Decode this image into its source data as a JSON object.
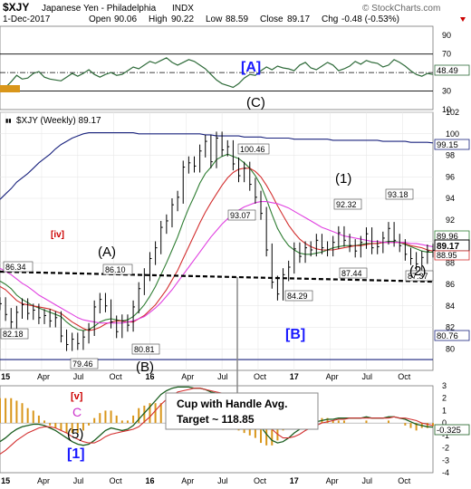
{
  "header": {
    "symbol": "$XJY",
    "name": "Japanese Yen - Philadelphia",
    "exchange": "INDX",
    "date": "1-Dec-2017",
    "open_label": "Open",
    "open": "90.06",
    "high_label": "High",
    "high": "90.22",
    "low_label": "Low",
    "low": "88.59",
    "close_label": "Close",
    "close": "89.17",
    "chg_label": "Chg",
    "chg": "-0.48 (-0.53%)",
    "watermark": "© StockCharts.com"
  },
  "colors": {
    "price": "#000000",
    "ma_green": "#2e7d32",
    "ma_red": "#d32f2f",
    "ma_magenta": "#e040e0",
    "ma_navy": "#1a237e",
    "rsi_line": "#2f6b3a",
    "macd_line": "#1b5e20",
    "signal_line": "#d32f2f",
    "hist": "#d9961a",
    "wave_blue": "#1a1aff",
    "wave_red": "#cc0000",
    "wave_magenta": "#cc33cc"
  },
  "chart_data": [
    {
      "type": "line",
      "title": "",
      "ylim": [
        10,
        100
      ],
      "y_ticks": [
        10,
        30,
        50,
        70,
        90
      ],
      "reference_lines": [
        70,
        50,
        30
      ],
      "last_value": "48.49",
      "x_ticks": [
        "15",
        "Apr",
        "Jul",
        "Oct",
        "16",
        "Apr",
        "Jul",
        "Oct",
        "17",
        "Apr",
        "Jul",
        "Oct"
      ],
      "x": [
        0,
        2,
        4,
        6,
        8,
        10,
        12,
        14,
        16,
        18,
        20,
        22,
        24,
        26,
        28,
        30,
        32,
        34,
        36,
        38,
        40,
        42,
        44,
        46,
        48,
        50,
        52,
        54,
        56,
        58,
        60,
        62,
        64,
        66,
        68,
        70,
        72,
        74,
        76,
        78,
        80,
        82,
        84,
        86,
        88,
        90,
        92,
        94,
        96,
        98,
        100,
        102,
        104,
        106,
        108,
        110,
        112,
        114,
        116,
        118,
        120,
        122,
        124,
        126,
        128,
        130,
        132,
        134,
        136,
        138,
        140,
        142,
        144,
        146,
        148,
        150,
        152,
        154,
        156
      ],
      "series": [
        {
          "name": "",
          "values": [
            30,
            34,
            40,
            47,
            43,
            44,
            49,
            51,
            45,
            43,
            42,
            41,
            45,
            49,
            46,
            49,
            53,
            48,
            45,
            48,
            50,
            47,
            48,
            52,
            56,
            54,
            58,
            62,
            60,
            63,
            66,
            61,
            58,
            61,
            64,
            62,
            58,
            54,
            48,
            42,
            38,
            36,
            34,
            38,
            44,
            48,
            47,
            52,
            56,
            53,
            57,
            55,
            54,
            52,
            58,
            61,
            55,
            53,
            57,
            61,
            58,
            52,
            54,
            57,
            62,
            59,
            63,
            61,
            60,
            56,
            58,
            64,
            61,
            57,
            52,
            48,
            46,
            49,
            48
          ]
        }
      ]
    },
    {
      "type": "line",
      "title": "$XJY (Weekly) 89.17",
      "ylim": [
        78,
        102
      ],
      "y_ticks": [
        80,
        82,
        84,
        86,
        88,
        90,
        92,
        94,
        96,
        98,
        100,
        102
      ],
      "x_ticks": [
        "15",
        "Apr",
        "Jul",
        "Oct",
        "16",
        "Apr",
        "Jul",
        "Oct",
        "17",
        "Apr",
        "Jul",
        "Oct"
      ],
      "x": [
        0,
        2,
        4,
        6,
        8,
        10,
        12,
        14,
        16,
        18,
        20,
        22,
        24,
        26,
        28,
        30,
        32,
        34,
        36,
        38,
        40,
        42,
        44,
        46,
        48,
        50,
        52,
        54,
        56,
        58,
        60,
        62,
        64,
        66,
        68,
        70,
        72,
        74,
        76,
        78,
        80,
        82,
        84,
        86,
        88,
        90,
        92,
        94,
        96,
        98,
        100,
        102,
        104,
        106,
        108,
        110,
        112,
        114,
        116,
        118,
        120,
        122,
        124,
        126,
        128,
        130,
        132,
        134,
        136,
        138,
        140,
        142,
        144,
        146,
        148,
        150,
        152,
        154,
        156
      ],
      "series": [
        {
          "name": "",
          "values": [
            84.2,
            83.2,
            82.5,
            83.4,
            84.1,
            83.3,
            83.6,
            82.9,
            83.1,
            82.6,
            82.9,
            81.2,
            80.4,
            80.9,
            80.5,
            81.1,
            81.8,
            83.9,
            84.6,
            84.0,
            82.5,
            81.6,
            82.6,
            82.2,
            83.9,
            85.6,
            86.9,
            88.4,
            89.4,
            91.3,
            91.9,
            93.4,
            94.1,
            96.9,
            97.3,
            97.0,
            98.4,
            99.3,
            97.4,
            99.6,
            98.5,
            98.8,
            97.2,
            96.1,
            96.8,
            95.3,
            94.1,
            92.6,
            89.2,
            86.2,
            85.1,
            86.9,
            87.6,
            89.3,
            88.6,
            89.4,
            89.2,
            90.1,
            89.4,
            89.2,
            89.9,
            90.8,
            90.1,
            89.6,
            89.1,
            89.9,
            90.7,
            89.4,
            89.5,
            90.3,
            91.2,
            90.1,
            89.6,
            88.8,
            88.4,
            87.9,
            88.5,
            89.1,
            89.17
          ]
        },
        {
          "name": "",
          "values": [
            86.3,
            86.0,
            85.6,
            85.0,
            84.6,
            84.3,
            84.0,
            83.8,
            83.6,
            83.4,
            83.2,
            83.0,
            82.5,
            82.1,
            81.8,
            81.7,
            81.8,
            82.1,
            82.5,
            82.7,
            82.8,
            82.7,
            82.6,
            82.7,
            83.0,
            83.5,
            84.1,
            84.9,
            85.8,
            86.9,
            88.0,
            89.2,
            90.4,
            91.8,
            93.1,
            94.2,
            95.4,
            96.3,
            96.9,
            97.6,
            97.9,
            98.1,
            97.9,
            97.7,
            97.3,
            96.8,
            96.1,
            95.2,
            93.9,
            92.5,
            91.2,
            90.3,
            89.6,
            89.2,
            88.9,
            88.8,
            88.8,
            88.9,
            89.0,
            89.2,
            89.4,
            89.5,
            89.6,
            89.6,
            89.6,
            89.7,
            89.8,
            89.8,
            89.8,
            89.9,
            90.0,
            90.0,
            89.9,
            89.7,
            89.5,
            89.3,
            89.1,
            89.0,
            89.0
          ]
        },
        {
          "name": "",
          "values": [
            85.8,
            85.5,
            85.0,
            84.5,
            84.2,
            84.1,
            84.0,
            83.9,
            83.8,
            83.7,
            83.5,
            83.3,
            82.9,
            82.5,
            82.2,
            81.9,
            81.7,
            81.8,
            82.0,
            82.3,
            82.5,
            82.6,
            82.6,
            82.5,
            82.5,
            82.8,
            83.1,
            83.6,
            84.1,
            84.8,
            85.5,
            86.4,
            87.3,
            88.4,
            89.5,
            90.6,
            91.7,
            92.7,
            93.6,
            94.4,
            95.2,
            95.9,
            96.4,
            96.7,
            96.8,
            96.8,
            96.5,
            96.0,
            95.2,
            94.3,
            93.3,
            92.4,
            91.5,
            90.8,
            90.2,
            89.8,
            89.5,
            89.3,
            89.2,
            89.2,
            89.2,
            89.3,
            89.4,
            89.5,
            89.6,
            89.6,
            89.7,
            89.8,
            89.8,
            89.9,
            89.9,
            89.9,
            89.9,
            89.8,
            89.6,
            89.5,
            89.4,
            89.2,
            89.1
          ]
        },
        {
          "name": "",
          "values": [
            87.5,
            87.2,
            86.9,
            86.5,
            86.1,
            85.8,
            85.4,
            85.0,
            84.7,
            84.4,
            84.1,
            83.8,
            83.5,
            83.2,
            82.9,
            82.7,
            82.6,
            82.5,
            82.4,
            82.4,
            82.4,
            82.4,
            82.4,
            82.5,
            82.6,
            82.8,
            83.0,
            83.4,
            83.8,
            84.3,
            84.9,
            85.5,
            86.2,
            86.9,
            87.6,
            88.3,
            89.0,
            89.7,
            90.4,
            91.0,
            91.6,
            92.1,
            92.5,
            92.9,
            93.2,
            93.4,
            93.6,
            93.7,
            93.7,
            93.6,
            93.5,
            93.3,
            93.1,
            92.8,
            92.5,
            92.2,
            91.9,
            91.6,
            91.3,
            91.1,
            90.9,
            90.7,
            90.5,
            90.4,
            90.3,
            90.2,
            90.1,
            90.0,
            90.0,
            89.9,
            89.9,
            89.9,
            89.9,
            89.9,
            89.8,
            89.8,
            89.7,
            89.6,
            89.5
          ]
        },
        {
          "name": "",
          "values": [
            93.9,
            94.4,
            94.9,
            95.5,
            95.9,
            96.3,
            96.8,
            97.3,
            97.7,
            98.1,
            98.6,
            99.0,
            99.3,
            99.6,
            99.8,
            100.0,
            100.1,
            100.1,
            100.1,
            100.1,
            100.1,
            100.1,
            100.1,
            100.1,
            100.1,
            100.0,
            100.0,
            100.0,
            100.0,
            100.0,
            100.0,
            100.0,
            100.0,
            100.0,
            100.0,
            100.0,
            100.0,
            99.9,
            99.9,
            99.8,
            99.8,
            99.8,
            99.8,
            99.8,
            99.7,
            99.7,
            99.7,
            99.7,
            99.6,
            99.6,
            99.6,
            99.6,
            99.6,
            99.5,
            99.5,
            99.5,
            99.5,
            99.5,
            99.5,
            99.5,
            99.4,
            99.4,
            99.4,
            99.4,
            99.4,
            99.4,
            99.4,
            99.4,
            99.4,
            99.3,
            99.3,
            99.3,
            99.3,
            99.3,
            99.2,
            99.2,
            99.2,
            99.2,
            99.15
          ]
        },
        {
          "name": "",
          "values": [
            79.0,
            79.0,
            79.0,
            79.0,
            79.0,
            79.0,
            79.0,
            79.0,
            79.0,
            79.0,
            79.0,
            79.0,
            79.0,
            79.0,
            79.0,
            79.0,
            79.0,
            79.0,
            79.0,
            79.0,
            79.0,
            79.0,
            79.0,
            79.0,
            79.0,
            79.0,
            79.0,
            79.0,
            79.0,
            79.0,
            79.0,
            79.0,
            79.0,
            79.0,
            79.0,
            79.0,
            79.0,
            79.0,
            79.0,
            79.0,
            79.0,
            79.0,
            79.0,
            79.0,
            79.0,
            79.0,
            79.0,
            79.0,
            79.0,
            79.0,
            79.0,
            79.0,
            79.0,
            79.0,
            79.0,
            79.0,
            79.0,
            79.0,
            79.0,
            79.0,
            79.0,
            79.0,
            79.0,
            79.0,
            79.0,
            79.0,
            79.0,
            79.0,
            79.0,
            79.0,
            79.0,
            79.0,
            79.0,
            79.0,
            79.0,
            79.0,
            79.0,
            79.0,
            79.0
          ]
        }
      ],
      "right_labels": [
        "99.15",
        "89.96",
        "89.17",
        "88.95",
        "80.76"
      ],
      "price_labels": [
        "86.34",
        "86.10",
        "82.18",
        "79.46",
        "80.81",
        "100.46",
        "93.07",
        "84.29",
        "92.32",
        "93.18",
        "87.44",
        "87.37"
      ],
      "wave_labels": [
        "[A]",
        "(C)",
        "(A)",
        "(B)",
        "[iv]",
        "(1)",
        "(2)",
        "[B]"
      ],
      "annotations": [
        "Cup with Handle Avg.",
        "Target ~ 118.85"
      ]
    },
    {
      "type": "line",
      "title": "",
      "ylim": [
        -4,
        3
      ],
      "y_ticks": [
        -4,
        -3,
        -2,
        -1,
        0,
        1,
        2,
        3
      ],
      "last_value": "-0.325",
      "x_ticks": [
        "15",
        "Apr",
        "Jul",
        "Oct",
        "16",
        "Apr",
        "Jul",
        "Oct",
        "17",
        "Apr",
        "Jul",
        "Oct"
      ],
      "wave_labels": [
        "[v]",
        "C",
        "(5)",
        "[1]"
      ],
      "x": [
        0,
        2,
        4,
        6,
        8,
        10,
        12,
        14,
        16,
        18,
        20,
        22,
        24,
        26,
        28,
        30,
        32,
        34,
        36,
        38,
        40,
        42,
        44,
        46,
        48,
        50,
        52,
        54,
        56,
        58,
        60,
        62,
        64,
        66,
        68,
        70,
        72,
        74,
        76,
        78,
        80,
        82,
        84,
        86,
        88,
        90,
        92,
        94,
        96,
        98,
        100,
        102,
        104,
        106,
        108,
        110,
        112,
        114,
        116,
        118,
        120,
        122,
        124,
        126,
        128,
        130,
        132,
        134,
        136,
        138,
        140,
        142,
        144,
        146,
        148,
        150,
        152,
        154,
        156
      ],
      "series": [
        {
          "name": "",
          "values": [
            -1.5,
            -1.2,
            -0.8,
            -0.5,
            -0.3,
            -0.2,
            -0.1,
            -0.1,
            -0.2,
            -0.4,
            -0.6,
            -0.9,
            -1.2,
            -1.5,
            -1.7,
            -1.8,
            -1.7,
            -1.4,
            -1.0,
            -0.6,
            -0.4,
            -0.5,
            -0.6,
            -0.5,
            -0.2,
            0.3,
            0.8,
            1.3,
            1.8,
            2.3,
            2.6,
            2.8,
            2.9,
            2.9,
            2.9,
            2.8,
            2.8,
            2.7,
            2.5,
            2.4,
            2.2,
            2.0,
            1.8,
            1.5,
            1.2,
            0.8,
            0.3,
            -0.3,
            -0.9,
            -1.4,
            -1.6,
            -1.5,
            -1.2,
            -0.8,
            -0.5,
            -0.3,
            -0.1,
            0.1,
            0.2,
            0.3,
            0.3,
            0.4,
            0.4,
            0.4,
            0.4,
            0.4,
            0.5,
            0.4,
            0.4,
            0.4,
            0.5,
            0.5,
            0.4,
            0.3,
            0.1,
            -0.1,
            -0.2,
            -0.3,
            -0.325
          ]
        },
        {
          "name": "",
          "values": [
            -2.5,
            -2.2,
            -1.8,
            -1.4,
            -1.1,
            -0.8,
            -0.6,
            -0.4,
            -0.3,
            -0.3,
            -0.4,
            -0.6,
            -0.8,
            -1.1,
            -1.3,
            -1.5,
            -1.6,
            -1.6,
            -1.4,
            -1.1,
            -0.9,
            -0.8,
            -0.7,
            -0.6,
            -0.5,
            -0.3,
            0.1,
            0.5,
            1.0,
            1.5,
            1.9,
            2.2,
            2.5,
            2.6,
            2.7,
            2.8,
            2.8,
            2.7,
            2.6,
            2.5,
            2.4,
            2.2,
            2.0,
            1.8,
            1.6,
            1.3,
            0.9,
            0.5,
            0.0,
            -0.5,
            -0.9,
            -1.2,
            -1.2,
            -1.1,
            -0.9,
            -0.6,
            -0.4,
            -0.2,
            0.0,
            0.1,
            0.2,
            0.3,
            0.3,
            0.4,
            0.4,
            0.4,
            0.4,
            0.4,
            0.4,
            0.4,
            0.4,
            0.5,
            0.4,
            0.4,
            0.3,
            0.2,
            0.0,
            -0.1,
            -0.2
          ]
        }
      ]
    }
  ]
}
